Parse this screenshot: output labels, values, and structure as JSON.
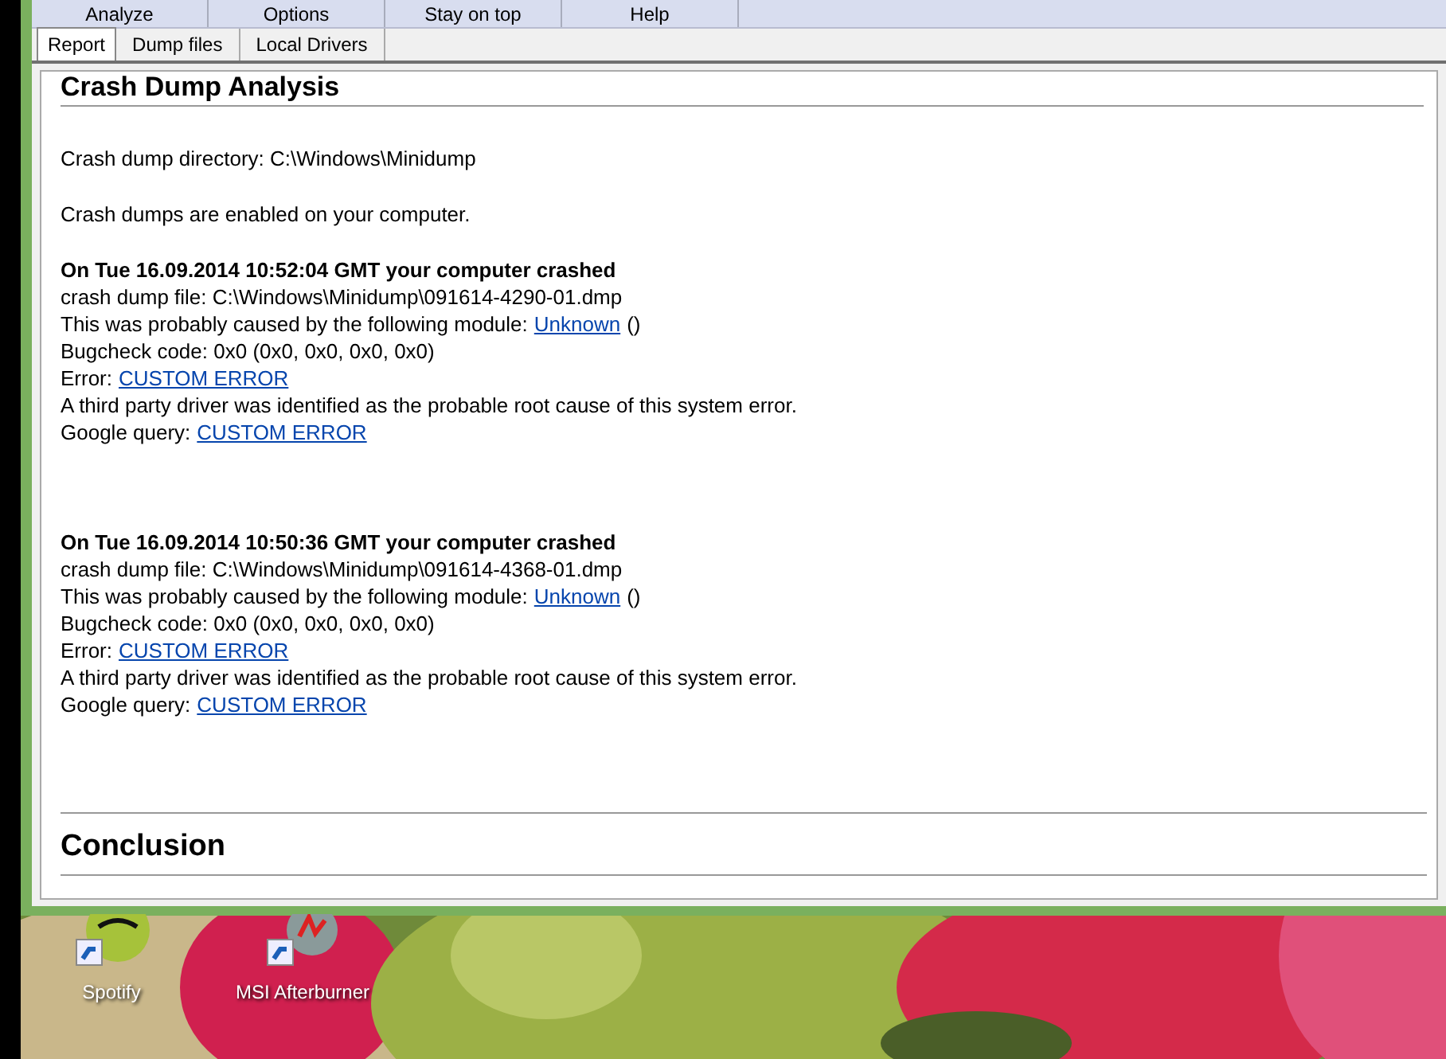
{
  "menu": [
    "Analyze",
    "Options",
    "Stay on top",
    "Help"
  ],
  "tabs": [
    {
      "label": "Report",
      "selected": true
    },
    {
      "label": "Dump files",
      "selected": false
    },
    {
      "label": "Local Drivers",
      "selected": false
    }
  ],
  "report": {
    "title": "Crash Dump Analysis",
    "intro": [
      "Crash dump directory: C:\\Windows\\Minidump",
      "Crash dumps are enabled on your computer."
    ],
    "crashes": [
      {
        "heading": "On Tue 16.09.2014 10:52:04 GMT your computer crashed",
        "lines": [
          {
            "text": "crash dump file: C:\\Windows\\Minidump\\091614-4290-01.dmp"
          },
          {
            "text": "This was probably caused by the following module:",
            "link": "Unknown",
            "suffix": "()"
          },
          {
            "text": "Bugcheck code: 0x0 (0x0, 0x0, 0x0, 0x0)"
          },
          {
            "text": "Error:",
            "link": "CUSTOM ERROR"
          },
          {
            "text": "A third party driver was identified as the probable root cause of this system error."
          },
          {
            "text": "Google query:",
            "link": "CUSTOM ERROR"
          }
        ]
      },
      {
        "heading": "On Tue 16.09.2014 10:50:36 GMT your computer crashed",
        "lines": [
          {
            "text": "crash dump file: C:\\Windows\\Minidump\\091614-4368-01.dmp"
          },
          {
            "text": "This was probably caused by the following module:",
            "link": "Unknown",
            "suffix": "()"
          },
          {
            "text": "Bugcheck code: 0x0 (0x0, 0x0, 0x0, 0x0)"
          },
          {
            "text": "Error:",
            "link": "CUSTOM ERROR"
          },
          {
            "text": "A third party driver was identified as the probable root cause of this system error."
          },
          {
            "text": "Google query:",
            "link": "CUSTOM ERROR"
          }
        ]
      }
    ],
    "conclusion": "Conclusion"
  },
  "desktop_icons": [
    {
      "label": "Spotify",
      "kind": "spotify"
    },
    {
      "label": "MSI Afterburner",
      "kind": "afterburner"
    }
  ]
}
